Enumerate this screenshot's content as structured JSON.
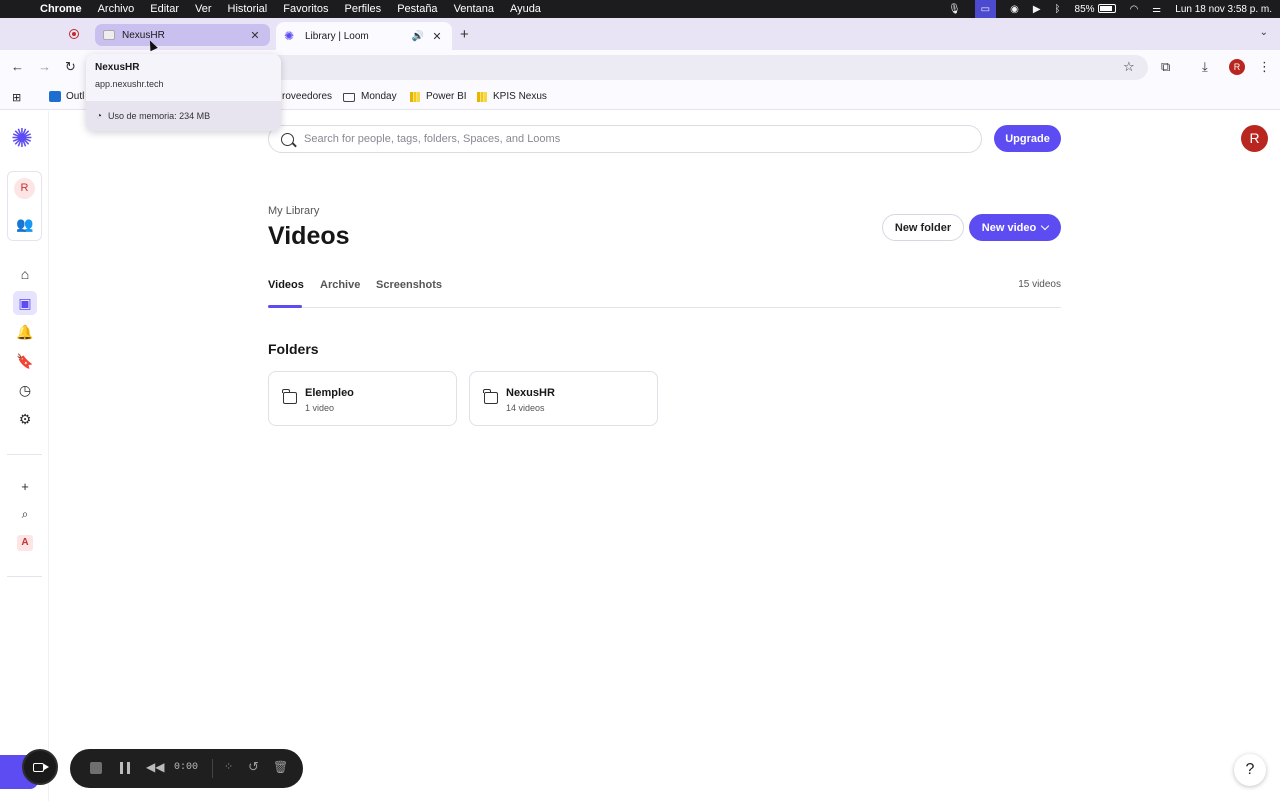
{
  "menubar": {
    "app": "Chrome",
    "items": [
      "Archivo",
      "Editar",
      "Ver",
      "Historial",
      "Favoritos",
      "Perfiles",
      "Pestaña",
      "Ventana",
      "Ayuda"
    ],
    "battery": "85%",
    "datetime": "Lun 18 nov  3:58 p. m."
  },
  "tabs": [
    {
      "title": "NexusHR"
    },
    {
      "title": "Library | Loom"
    }
  ],
  "hovercard": {
    "title": "NexusHR",
    "url": "app.nexushr.tech",
    "memory": "Uso de memoria: 234 MB"
  },
  "bookmarks": {
    "outlook": "Outl",
    "proveedores": "roveedores",
    "monday": "Monday",
    "powerbi": "Power BI",
    "kpis": "KPIS Nexus"
  },
  "rail": {
    "avatar_letter": "R",
    "workspace_letter": "A"
  },
  "search": {
    "placeholder": "Search for people, tags, folders, Spaces, and Looms"
  },
  "header": {
    "upgrade": "Upgrade",
    "avatar_letter": "R",
    "avatar_color": "#b8261f"
  },
  "library": {
    "breadcrumb": "My Library",
    "title": "Videos",
    "new_folder": "New folder",
    "new_video": "New video",
    "tabs": [
      "Videos",
      "Archive",
      "Screenshots"
    ],
    "active_tab": "Videos",
    "count": "15 videos",
    "folders_heading": "Folders",
    "folders": [
      {
        "name": "Elempleo",
        "sub": "1 video"
      },
      {
        "name": "NexusHR",
        "sub": "14 videos"
      }
    ]
  },
  "recorder": {
    "time": "0:00"
  },
  "help": "?",
  "colors": {
    "accent": "#5d4cf2",
    "tab_active": "#cac0ef"
  }
}
